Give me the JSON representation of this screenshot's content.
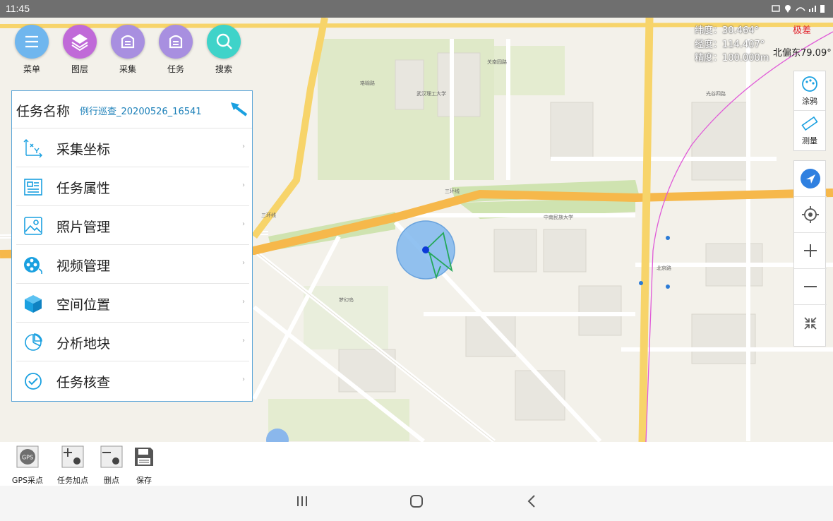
{
  "status": {
    "time": "11:45"
  },
  "top_buttons": [
    {
      "label": "菜单",
      "color": "#6fb6ee",
      "icon": "list-icon"
    },
    {
      "label": "图层",
      "color": "#c06ad8",
      "icon": "layers-icon"
    },
    {
      "label": "采集",
      "color": "#a88fe0",
      "icon": "collect-icon"
    },
    {
      "label": "任务",
      "color": "#a88fe0",
      "icon": "task-icon"
    },
    {
      "label": "搜索",
      "color": "#3fd3c9",
      "icon": "search-icon"
    }
  ],
  "map_info": {
    "latitude": "纬度：30.464°",
    "longitude": "经度：114.407°",
    "precision": "精度：100.000m",
    "accuracy_label": "极差",
    "heading": "北偏东79.09°"
  },
  "right_tools": {
    "doodle": "涂鸦",
    "measure": "测量"
  },
  "panel": {
    "title": "任务名称",
    "task_name": "例行巡查_20200526_16541",
    "items": [
      {
        "label": "采集坐标",
        "icon": "coordinate-icon"
      },
      {
        "label": "任务属性",
        "icon": "attributes-icon"
      },
      {
        "label": "照片管理",
        "icon": "photo-icon"
      },
      {
        "label": "视频管理",
        "icon": "video-icon"
      },
      {
        "label": "空间位置",
        "icon": "cube-icon"
      },
      {
        "label": "分析地块",
        "icon": "pie-icon"
      },
      {
        "label": "任务核查",
        "icon": "check-icon"
      }
    ]
  },
  "bottom_tools": [
    {
      "label": "GPS采点",
      "icon": "gps-icon"
    },
    {
      "label": "任务加点",
      "icon": "add-point-icon"
    },
    {
      "label": "删点",
      "icon": "delete-point-icon"
    },
    {
      "label": "保存",
      "icon": "save-icon"
    }
  ],
  "map_labels": [
    "三环线",
    "梦幻岛",
    "三环线",
    "北京路",
    "中南民族大学",
    "武汉理工大学",
    "珞喻路",
    "关南园路",
    "光谷四路"
  ]
}
